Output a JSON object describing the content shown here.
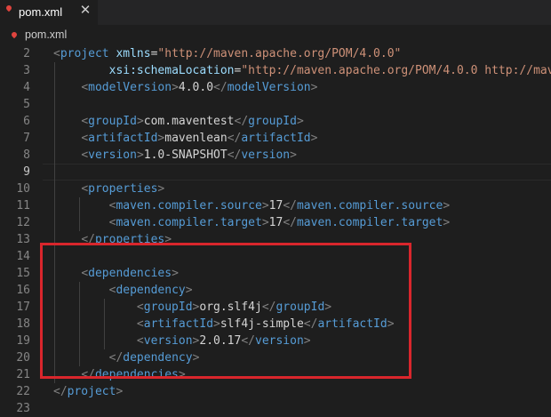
{
  "tab": {
    "label": "pom.xml",
    "close_glyph": "✕"
  },
  "breadcrumb": {
    "label": "pom.xml"
  },
  "lines": [
    {
      "n": "2",
      "tokens": [
        [
          "b",
          "<"
        ],
        [
          "t",
          "project"
        ],
        [
          "x",
          " "
        ],
        [
          "a",
          "xmlns"
        ],
        [
          "x",
          "="
        ],
        [
          "s",
          "\"http://maven.apache.org/POM/4.0.0\""
        ]
      ]
    },
    {
      "n": "3",
      "tokens": [
        [
          "x",
          "        "
        ],
        [
          "a",
          "xsi:schemaLocation"
        ],
        [
          "x",
          "="
        ],
        [
          "s",
          "\"http://maven.apache.org/POM/4.0.0 http://mave"
        ]
      ]
    },
    {
      "n": "4",
      "tokens": [
        [
          "x",
          "    "
        ],
        [
          "b",
          "<"
        ],
        [
          "t",
          "modelVersion"
        ],
        [
          "b",
          ">"
        ],
        [
          "x",
          "4.0.0"
        ],
        [
          "b",
          "</"
        ],
        [
          "t",
          "modelVersion"
        ],
        [
          "b",
          ">"
        ]
      ]
    },
    {
      "n": "5",
      "tokens": []
    },
    {
      "n": "6",
      "tokens": [
        [
          "x",
          "    "
        ],
        [
          "b",
          "<"
        ],
        [
          "t",
          "groupId"
        ],
        [
          "b",
          ">"
        ],
        [
          "x",
          "com.maventest"
        ],
        [
          "b",
          "</"
        ],
        [
          "t",
          "groupId"
        ],
        [
          "b",
          ">"
        ]
      ]
    },
    {
      "n": "7",
      "tokens": [
        [
          "x",
          "    "
        ],
        [
          "b",
          "<"
        ],
        [
          "t",
          "artifactId"
        ],
        [
          "b",
          ">"
        ],
        [
          "x",
          "mavenlean"
        ],
        [
          "b",
          "</"
        ],
        [
          "t",
          "artifactId"
        ],
        [
          "b",
          ">"
        ]
      ]
    },
    {
      "n": "8",
      "tokens": [
        [
          "x",
          "    "
        ],
        [
          "b",
          "<"
        ],
        [
          "t",
          "version"
        ],
        [
          "b",
          ">"
        ],
        [
          "x",
          "1.0-SNAPSHOT"
        ],
        [
          "b",
          "</"
        ],
        [
          "t",
          "version"
        ],
        [
          "b",
          ">"
        ]
      ]
    },
    {
      "n": "9",
      "tokens": [],
      "current": true
    },
    {
      "n": "10",
      "tokens": [
        [
          "x",
          "    "
        ],
        [
          "b",
          "<"
        ],
        [
          "t",
          "properties"
        ],
        [
          "b",
          ">"
        ]
      ]
    },
    {
      "n": "11",
      "tokens": [
        [
          "x",
          "        "
        ],
        [
          "b",
          "<"
        ],
        [
          "t",
          "maven.compiler.source"
        ],
        [
          "b",
          ">"
        ],
        [
          "x",
          "17"
        ],
        [
          "b",
          "</"
        ],
        [
          "t",
          "maven.compiler.source"
        ],
        [
          "b",
          ">"
        ]
      ]
    },
    {
      "n": "12",
      "tokens": [
        [
          "x",
          "        "
        ],
        [
          "b",
          "<"
        ],
        [
          "t",
          "maven.compiler.target"
        ],
        [
          "b",
          ">"
        ],
        [
          "x",
          "17"
        ],
        [
          "b",
          "</"
        ],
        [
          "t",
          "maven.compiler.target"
        ],
        [
          "b",
          ">"
        ]
      ]
    },
    {
      "n": "13",
      "tokens": [
        [
          "x",
          "    "
        ],
        [
          "b",
          "</"
        ],
        [
          "t",
          "properties"
        ],
        [
          "b",
          ">"
        ]
      ]
    },
    {
      "n": "14",
      "tokens": []
    },
    {
      "n": "15",
      "tokens": [
        [
          "x",
          "    "
        ],
        [
          "b",
          "<"
        ],
        [
          "t",
          "dependencies"
        ],
        [
          "b",
          ">"
        ]
      ]
    },
    {
      "n": "16",
      "tokens": [
        [
          "x",
          "        "
        ],
        [
          "b",
          "<"
        ],
        [
          "t",
          "dependency"
        ],
        [
          "b",
          ">"
        ]
      ]
    },
    {
      "n": "17",
      "tokens": [
        [
          "x",
          "            "
        ],
        [
          "b",
          "<"
        ],
        [
          "t",
          "groupId"
        ],
        [
          "b",
          ">"
        ],
        [
          "x",
          "org.slf4j"
        ],
        [
          "b",
          "</"
        ],
        [
          "t",
          "groupId"
        ],
        [
          "b",
          ">"
        ]
      ]
    },
    {
      "n": "18",
      "tokens": [
        [
          "x",
          "            "
        ],
        [
          "b",
          "<"
        ],
        [
          "t",
          "artifactId"
        ],
        [
          "b",
          ">"
        ],
        [
          "x",
          "slf4j-simple"
        ],
        [
          "b",
          "</"
        ],
        [
          "t",
          "artifactId"
        ],
        [
          "b",
          ">"
        ]
      ]
    },
    {
      "n": "19",
      "tokens": [
        [
          "x",
          "            "
        ],
        [
          "b",
          "<"
        ],
        [
          "t",
          "version"
        ],
        [
          "b",
          ">"
        ],
        [
          "x",
          "2.0.17"
        ],
        [
          "b",
          "</"
        ],
        [
          "t",
          "version"
        ],
        [
          "b",
          ">"
        ]
      ]
    },
    {
      "n": "20",
      "tokens": [
        [
          "x",
          "        "
        ],
        [
          "b",
          "</"
        ],
        [
          "t",
          "dependency"
        ],
        [
          "b",
          ">"
        ]
      ]
    },
    {
      "n": "21",
      "tokens": [
        [
          "x",
          "    "
        ],
        [
          "b",
          "</"
        ],
        [
          "t",
          "dependencies"
        ],
        [
          "b",
          ">"
        ]
      ]
    },
    {
      "n": "22",
      "tokens": [
        [
          "b",
          "</"
        ],
        [
          "t",
          "project"
        ],
        [
          "b",
          ">"
        ]
      ]
    }
  ],
  "line_numbers_visible": [
    "2",
    "3",
    "4",
    "5",
    "6",
    "7",
    "8",
    "9",
    "10",
    "11",
    "12",
    "13",
    "14",
    "15",
    "16",
    "17",
    "18",
    "19",
    "20",
    "21",
    "22",
    "23"
  ],
  "colors": {
    "background": "#1e1e1e",
    "tag": "#569cd6",
    "attribute": "#9cdcfe",
    "string": "#ce9178",
    "bracket": "#808080",
    "highlight_border": "#d9262c"
  }
}
